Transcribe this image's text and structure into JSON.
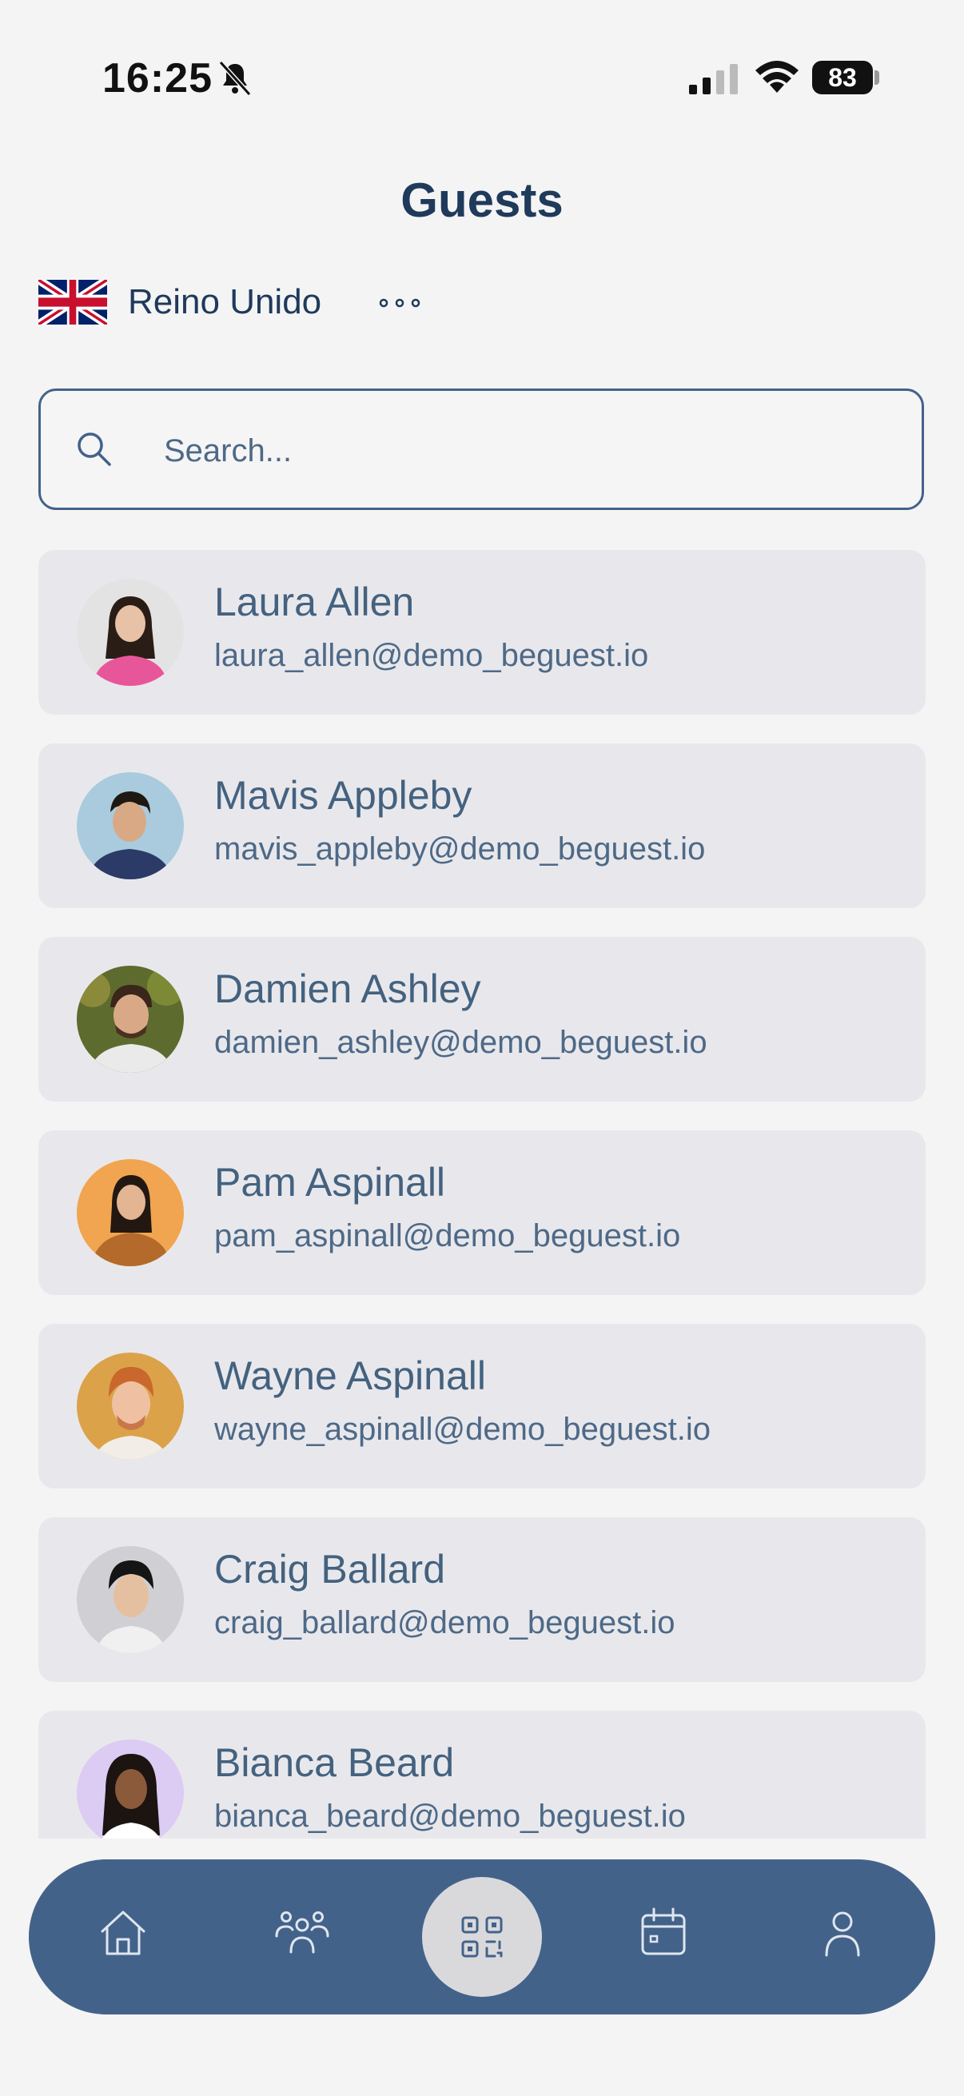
{
  "status_bar": {
    "time": "16:25",
    "battery": "83"
  },
  "header": {
    "title": "Guests"
  },
  "country": {
    "name": "Reino Unido",
    "flag_icon": "uk-flag-icon"
  },
  "search": {
    "placeholder": "Search..."
  },
  "guests": [
    {
      "name": "Laura Allen",
      "email": "laura_allen@demo_beguest.io"
    },
    {
      "name": "Mavis Appleby",
      "email": "mavis_appleby@demo_beguest.io"
    },
    {
      "name": "Damien Ashley",
      "email": "damien_ashley@demo_beguest.io"
    },
    {
      "name": "Pam Aspinall",
      "email": "pam_aspinall@demo_beguest.io"
    },
    {
      "name": "Wayne Aspinall",
      "email": "wayne_aspinall@demo_beguest.io"
    },
    {
      "name": "Craig Ballard",
      "email": "craig_ballard@demo_beguest.io"
    },
    {
      "name": "Bianca Beard",
      "email": "bianca_beard@demo_beguest.io"
    }
  ],
  "nav": {
    "items": [
      "home-icon",
      "guests-icon",
      "qr-code-icon",
      "calendar-icon",
      "profile-icon"
    ],
    "active": "qr-code-icon"
  },
  "colors": {
    "primary": "#43628a",
    "title": "#1f3a5a",
    "card": "#e8e8ec",
    "background": "#f4f4f5"
  }
}
